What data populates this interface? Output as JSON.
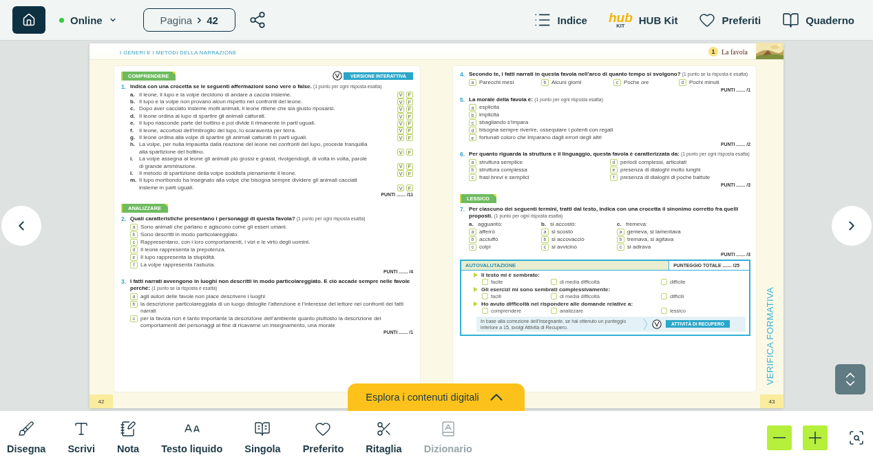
{
  "top_bar": {
    "status": {
      "label": "Online",
      "online": true
    },
    "page_field": {
      "label": "Pagina",
      "value": "42"
    },
    "nav": [
      {
        "kind": "list",
        "label": "Indice"
      },
      {
        "kind": "hub",
        "logo": "hub",
        "logo_sub": "KIT",
        "label": "HUB Kit"
      },
      {
        "kind": "heart",
        "label": "Preferiti"
      },
      {
        "kind": "book",
        "label": "Quaderno"
      }
    ]
  },
  "book": {
    "left_page": {
      "running_head": "I GENERI E I METODI DELLA NARRAZIONE",
      "page_number": "42",
      "sections": [
        {
          "tag": "COMPRENDERE",
          "badge": "VERSIONE INTERATTIVA",
          "exercises": [
            {
              "kind": "true_false",
              "number": "1.",
              "question": "Indica con una crocetta se le seguenti affermazioni sono vere o false.",
              "note": "(1 punto per ogni risposta esatta)",
              "items": [
                {
                  "marker": "a.",
                  "text": "Il leone, il lupo e la volpe decidono di andare a caccia insieme.",
                  "true_label": "V",
                  "false_label": "F"
                },
                {
                  "marker": "b.",
                  "text": "Il lupo e la volpe non provano alcun rispetto nei confronti del leone.",
                  "true_label": "V",
                  "false_label": "F"
                },
                {
                  "marker": "c.",
                  "text": "Dopo aver cacciato insieme molti animali, il leone ritiene che sia giusto riposarsi.",
                  "true_label": "V",
                  "false_label": "F"
                },
                {
                  "marker": "d.",
                  "text": "Il leone ordina al lupo di spartire gli animali catturati.",
                  "true_label": "V",
                  "false_label": "F"
                },
                {
                  "marker": "e.",
                  "text": "Il lupo nasconde parte del bottino e poi divide il rimanente in parti uguali.",
                  "true_label": "V",
                  "false_label": "F"
                },
                {
                  "marker": "f.",
                  "text": "Il leone, accortosi dell’imbroglio del lupo, lo scaraventa per terra.",
                  "true_label": "V",
                  "false_label": "F"
                },
                {
                  "marker": "g.",
                  "text": "Il leone ordina alla volpe di spartire gli animali catturati in parti uguali.",
                  "true_label": "V",
                  "false_label": "F"
                },
                {
                  "marker": "h.",
                  "text": "La volpe, per nulla impaurita dalla reazione del leone nei confronti del lupo, procede tranquilla alla spartizione del bottino.",
                  "true_label": "V",
                  "false_label": "F"
                },
                {
                  "marker": "i.",
                  "text": "La volpe assegna al leone gli animali più grossi e grassi, rivolgendogli, di volta in volta, parole di grande ammirazione.",
                  "true_label": "V",
                  "false_label": "F"
                },
                {
                  "marker": "l.",
                  "text": "Il metodo di spartizione della volpe soddisfa pienamente il leone.",
                  "true_label": "V",
                  "false_label": "F"
                },
                {
                  "marker": "m.",
                  "text": "Il lupo moribondo ha insegnato alla volpe che bisogna sempre dividere gli animali cacciati insieme in parti uguali.",
                  "true_label": "V",
                  "false_label": "F"
                }
              ],
              "score": "PUNTI ....... /11"
            }
          ]
        },
        {
          "tag": "ANALIZZARE",
          "exercises": [
            {
              "kind": "choice_list",
              "number": "2.",
              "question": "Quali caratteristiche presentano i personaggi di questa favola?",
              "note": "(1 punto per ogni risposta esatta)",
              "options": [
                {
                  "marker": "a",
                  "text": "Sono animali che parlano e agiscono come gli esseri umani."
                },
                {
                  "marker": "b",
                  "text": "Sono descritti in modo particolareggiato."
                },
                {
                  "marker": "c",
                  "text": "Rappresentano, con i loro comportamenti, i vizi e le virtù degli uomini."
                },
                {
                  "marker": "d",
                  "text": "Il leone rappresenta la prepotenza."
                },
                {
                  "marker": "e",
                  "text": "Il lupo rappresenta la stupidità."
                },
                {
                  "marker": "f",
                  "text": "La volpe rappresenta l’astuzia."
                }
              ],
              "score": "PUNTI ....... /4"
            },
            {
              "kind": "choice_list",
              "number": "3.",
              "question": "I fatti narrati avvengono in luoghi non descritti in modo particolareggiato. E ciò accade sempre nelle favole perché:",
              "note": "(1 punto se la risposta è esatta)",
              "options": [
                {
                  "marker": "a",
                  "text": "agli autori delle favole non piace descrivere i luoghi"
                },
                {
                  "marker": "b",
                  "text": "la descrizione particolareggiata di un luogo distoglie l’attenzione e l’interesse del lettore nei confronti dei fatti narrati"
                },
                {
                  "marker": "c",
                  "text": "per la favola non è tanto importante la descrizione dell’ambiente quanto piuttosto la descrizione dei comportamenti dei personaggi al fine di ricavarne un insegnamento, una morale"
                }
              ],
              "score": "PUNTI ....... /1"
            }
          ]
        }
      ]
    },
    "right_page": {
      "chapter": {
        "number": "1",
        "title": "La favola"
      },
      "page_number": "43",
      "side_label": "VERIFICA FORMATIVA",
      "sections": [
        {
          "exercises": [
            {
              "kind": "choice_row",
              "number": "4.",
              "question": "Secondo te, i fatti narrati in questa favola nell’arco di quanto tempo si svolgono?",
              "note": "(1 punto se la risposta è esatta)",
              "options": [
                {
                  "marker": "a",
                  "text": "Parecchi mesi"
                },
                {
                  "marker": "b",
                  "text": "Alcuni giorni"
                },
                {
                  "marker": "c",
                  "text": "Poche ore"
                },
                {
                  "marker": "d",
                  "text": "Pochi minuti"
                }
              ],
              "score": "PUNTI ....... /1"
            },
            {
              "kind": "choice_list",
              "number": "5.",
              "question": "La morale della favola è:",
              "note": "(1 punto per ogni risposta esatta)",
              "options": [
                {
                  "marker": "a",
                  "text": "esplicita"
                },
                {
                  "marker": "b",
                  "text": "implicita"
                },
                {
                  "marker": "c",
                  "text": "sbagliando s’impara"
                },
                {
                  "marker": "d",
                  "text": "bisogna sempre riverire, ossequiare i potenti con regali"
                },
                {
                  "marker": "e",
                  "text": "fortunati coloro che imparano dagli errori degli altri"
                }
              ],
              "score": "PUNTI ....... /2"
            },
            {
              "kind": "choice_grid",
              "number": "6.",
              "question": "Per quanto riguarda la struttura e il linguaggio, questa favola è caratterizzata da:",
              "note": "(1 punto per ogni risposta esatta)",
              "options": [
                {
                  "marker": "a",
                  "text": "struttura semplice"
                },
                {
                  "marker": "b",
                  "text": "struttura complessa"
                },
                {
                  "marker": "c",
                  "text": "frasi brevi e semplici"
                },
                {
                  "marker": "d",
                  "text": "periodi complessi, articolati"
                },
                {
                  "marker": "e",
                  "text": "presenza di dialoghi molto lunghi"
                },
                {
                  "marker": "f",
                  "text": "presenza di dialoghi di poche battute"
                }
              ],
              "score": "PUNTI ....... /3"
            }
          ]
        },
        {
          "tag": "LESSICO",
          "exercises": [
            {
              "kind": "term_columns",
              "number": "7.",
              "question": "Per ciascuno dei seguenti termini, tratti dal testo, indica con una crocetta il sinonimo corretto fra quelli proposti.",
              "note": "(1 punto per ogni risposta esatta)",
              "columns": [
                {
                  "marker": "a.",
                  "term": "agguantò:",
                  "options": [
                    {
                      "marker": "a",
                      "text": "afferrò"
                    },
                    {
                      "marker": "b",
                      "text": "acciuffò"
                    },
                    {
                      "marker": "c",
                      "text": "colpì"
                    }
                  ]
                },
                {
                  "marker": "b.",
                  "term": "si accostò:",
                  "options": [
                    {
                      "marker": "a",
                      "text": "si scostò"
                    },
                    {
                      "marker": "b",
                      "text": "si accovacciò"
                    },
                    {
                      "marker": "c",
                      "text": "si avvicinò"
                    }
                  ]
                },
                {
                  "marker": "c.",
                  "term": "fremeva:",
                  "options": [
                    {
                      "marker": "a",
                      "text": "gemeva, si lamentava"
                    },
                    {
                      "marker": "b",
                      "text": "tremava, si agitava"
                    },
                    {
                      "marker": "c",
                      "text": "si adirava"
                    }
                  ]
                }
              ],
              "score": "PUNTI ....... /3"
            }
          ]
        }
      ],
      "self_assessment": {
        "title": "AUTOVALUTAZIONE",
        "total": "PUNTEGGIO TOTALE ....... /25",
        "questions": [
          {
            "text": "Il testo mi è sembrato:",
            "options": [
              {
                "label": "facile",
                "checked": false
              },
              {
                "label": "di media difficoltà",
                "checked": false
              },
              {
                "label": "difficile",
                "checked": false
              }
            ]
          },
          {
            "text": "Gli esercizi mi sono sembrati complessivamente:",
            "options": [
              {
                "label": "facili",
                "checked": false
              },
              {
                "label": "di media difficoltà",
                "checked": false
              },
              {
                "label": "difficili",
                "checked": false
              }
            ]
          },
          {
            "text": "Ho avuto difficoltà nel rispondere alle domande relative a:",
            "options": [
              {
                "label": "comprendere",
                "checked": false
              },
              {
                "label": "analizzare",
                "checked": false
              },
              {
                "label": "lessico",
                "checked": false
              }
            ]
          }
        ],
        "footer": "In base alla correzione dell’insegnante, se hai ottenuto un punteggio inferiore a 15, svolgi Attività di Recupero.",
        "button": "ATTIVITÀ DI RECUPERO"
      }
    }
  },
  "explore_tab": {
    "label": "Esplora i contenuti digitali",
    "expanded": false
  },
  "toolbar": {
    "tools": [
      {
        "kind": "brush",
        "label": "Disegna",
        "disabled": false
      },
      {
        "kind": "text",
        "label": "Scrivi",
        "disabled": false
      },
      {
        "kind": "note",
        "label": "Nota",
        "disabled": false
      },
      {
        "kind": "liquid",
        "label": "Testo liquido",
        "disabled": false
      },
      {
        "kind": "single",
        "label": "Singola",
        "disabled": false
      },
      {
        "kind": "heart",
        "label": "Preferito",
        "disabled": false
      },
      {
        "kind": "cut",
        "label": "Ritaglia",
        "disabled": false
      },
      {
        "kind": "dictionary",
        "label": "Dizionario",
        "disabled": true
      }
    ]
  }
}
